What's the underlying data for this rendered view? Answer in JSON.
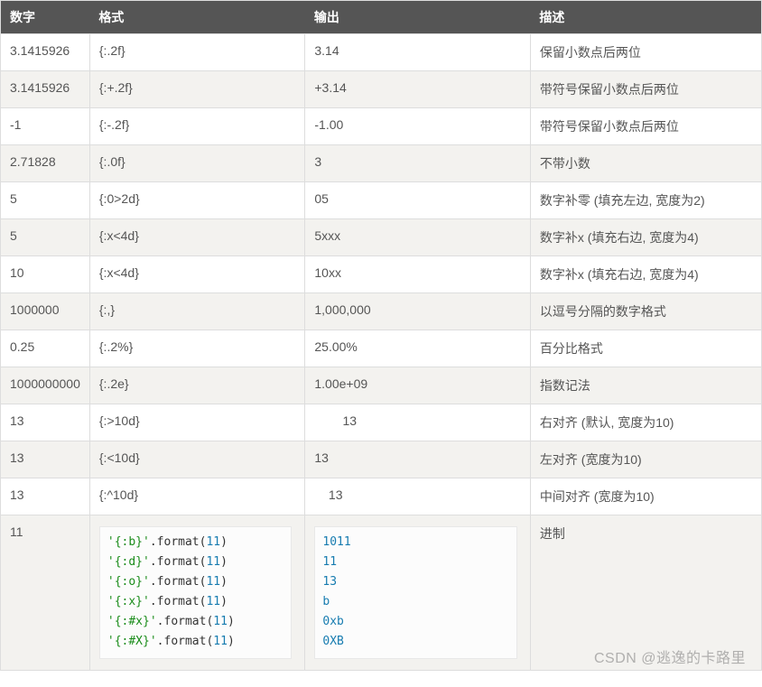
{
  "table": {
    "headers": {
      "col0": "数字",
      "col1": "格式",
      "col2": "输出",
      "col3": "描述"
    },
    "rows": [
      {
        "num": "3.1415926",
        "fmt": "{:.2f}",
        "out": "3.14",
        "desc": "保留小数点后两位"
      },
      {
        "num": "3.1415926",
        "fmt": "{:+.2f}",
        "out": "+3.14",
        "desc": "带符号保留小数点后两位"
      },
      {
        "num": "-1",
        "fmt": "{:-.2f}",
        "out": "-1.00",
        "desc": "带符号保留小数点后两位"
      },
      {
        "num": "2.71828",
        "fmt": "{:.0f}",
        "out": "3",
        "desc": "不带小数"
      },
      {
        "num": "5",
        "fmt": "{:0>2d}",
        "out": "05",
        "desc": "数字补零 (填充左边, 宽度为2)"
      },
      {
        "num": "5",
        "fmt": "{:x<4d}",
        "out": "5xxx",
        "desc": "数字补x (填充右边, 宽度为4)"
      },
      {
        "num": "10",
        "fmt": "{:x<4d}",
        "out": "10xx",
        "desc": "数字补x (填充右边, 宽度为4)"
      },
      {
        "num": "1000000",
        "fmt": "{:,}",
        "out": "1,000,000",
        "desc": "以逗号分隔的数字格式"
      },
      {
        "num": "0.25",
        "fmt": "{:.2%}",
        "out": "25.00%",
        "desc": "百分比格式"
      },
      {
        "num": "1000000000",
        "fmt": "{:.2e}",
        "out": "1.00e+09",
        "desc": "指数记法"
      },
      {
        "num": "13",
        "fmt": "{:>10d}",
        "out": "        13",
        "desc": "右对齐 (默认, 宽度为10)"
      },
      {
        "num": "13",
        "fmt": "{:<10d}",
        "out": "13",
        "desc": "左对齐 (宽度为10)"
      },
      {
        "num": "13",
        "fmt": "{:^10d}",
        "out": "    13",
        "desc": "中间对齐 (宽度为10)"
      }
    ],
    "lastRow": {
      "num": "11",
      "desc": "进制",
      "code": {
        "lines": [
          {
            "str": "'{:b}'",
            "fn": ".format(",
            "arg": "11",
            "close": ")"
          },
          {
            "str": "'{:d}'",
            "fn": ".format(",
            "arg": "11",
            "close": ")"
          },
          {
            "str": "'{:o}'",
            "fn": ".format(",
            "arg": "11",
            "close": ")"
          },
          {
            "str": "'{:x}'",
            "fn": ".format(",
            "arg": "11",
            "close": ")"
          },
          {
            "str": "'{:#x}'",
            "fn": ".format(",
            "arg": "11",
            "close": ")"
          },
          {
            "str": "'{:#X}'",
            "fn": ".format(",
            "arg": "11",
            "close": ")"
          }
        ]
      },
      "outputs": [
        "1011",
        "11",
        "13",
        "b",
        "0xb",
        "0XB"
      ]
    }
  },
  "watermark": "CSDN @逃逸的卡路里"
}
